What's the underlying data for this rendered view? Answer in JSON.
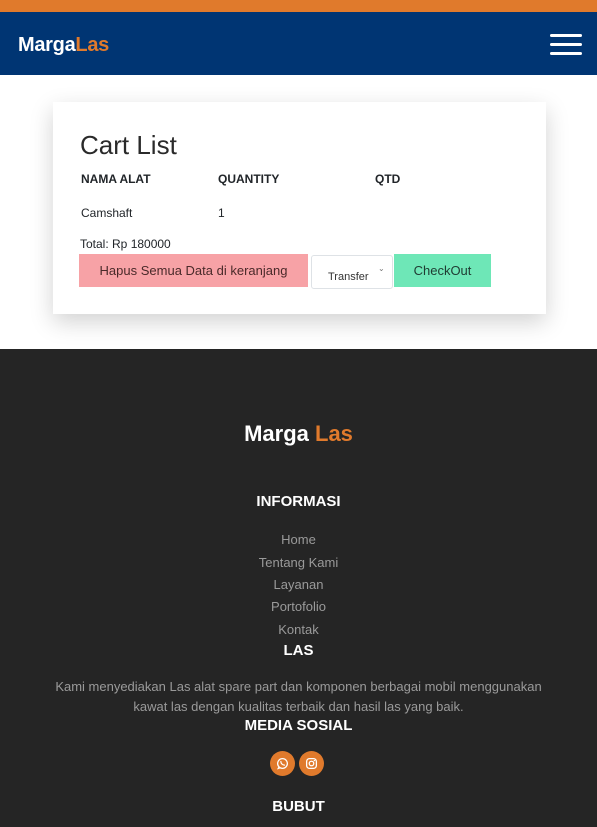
{
  "nav": {
    "brand_main": "Marga",
    "brand_accent": "Las",
    "menu_icon": "hamburger-menu-icon"
  },
  "cart": {
    "title": "Cart List",
    "columns": [
      "NAMA ALAT",
      "QUANTITY",
      "QTD"
    ],
    "rows": [
      {
        "name": "Camshaft",
        "quantity": "1",
        "qtd": ""
      }
    ],
    "total_label": "Total: Rp 180000",
    "clear_button": "Hapus Semua Data di keranjang",
    "payment_selected": "Transfer",
    "checkout_button": "CheckOut"
  },
  "footer": {
    "brand_main": "Marga",
    "brand_accent": "Las",
    "info_heading": "INFORMASI",
    "info_links": [
      "Home",
      "Tentang Kami",
      "Layanan",
      "Portofolio",
      "Kontak"
    ],
    "las_heading": "LAS",
    "las_description": "Kami menyediakan Las alat spare part dan komponen berbagai mobil menggunakan kawat las dengan kualitas terbaik dan hasil las yang baik.",
    "social_heading": "MEDIA SOSIAL",
    "social_icons": [
      "whatsapp-icon",
      "instagram-icon"
    ],
    "bubut_heading": "BUBUT"
  },
  "colors": {
    "navbar": "#003573",
    "accent": "#e07a2c",
    "clear_button": "#f7a2a6",
    "checkout_button": "#6ee7b7",
    "footer": "#252525"
  }
}
